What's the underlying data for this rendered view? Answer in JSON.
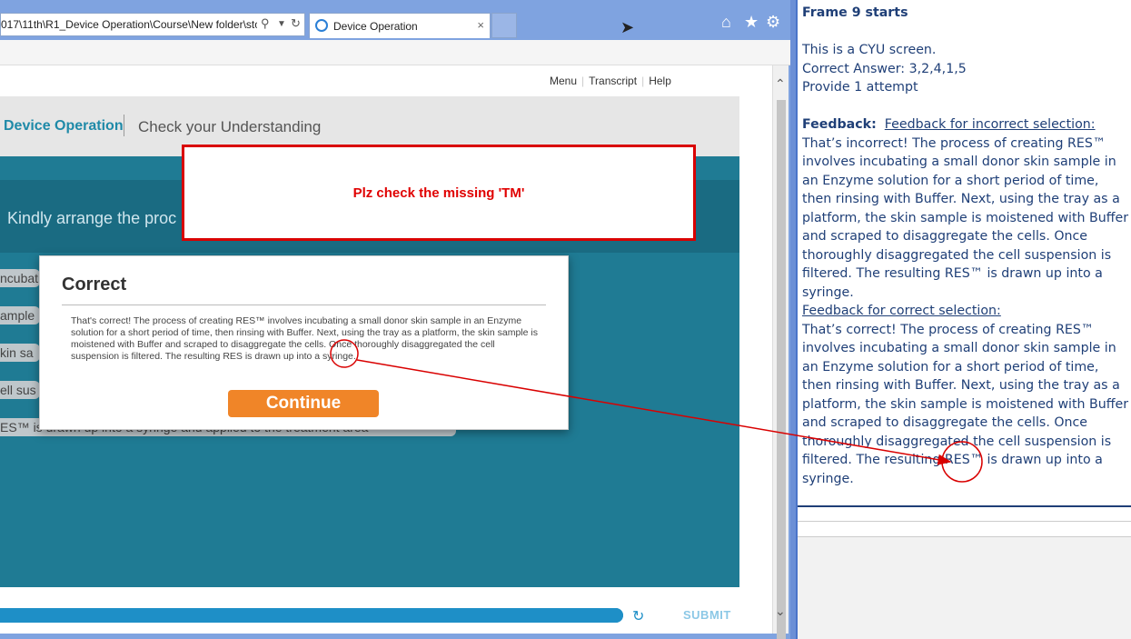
{
  "browser": {
    "address": "017\\11th\\R1_Device Operation\\Course\\New folder\\sto",
    "tab_title": "Device Operation",
    "tab_close": "×",
    "icons": [
      "search-icon",
      "dropdown-icon",
      "refresh-icon",
      "home-icon",
      "star-icon",
      "gear-icon"
    ]
  },
  "course": {
    "topnav": [
      "Menu",
      "Transcript",
      "Help"
    ],
    "title": "Device Operation",
    "section": "Check your Understanding",
    "question": "Kindly arrange the proc",
    "drag_items": [
      "ncubati",
      "ample",
      "kin sa",
      "ell sus",
      "ES™ is drawn up into a syringe and applied to the treatment area"
    ],
    "submit_label": "SUBMIT",
    "progress": 1.0
  },
  "modal": {
    "title": "Correct",
    "text": "That's correct! The process of creating RES™ involves incubating a small donor skin sample in an Enzyme solution for a short period of time, then rinsing with Buffer.  Next, using the tray as a platform, the skin sample is moistened with Buffer and scraped to disaggregate the cells.  Once thoroughly disaggregated the cell suspension is filtered. The resulting RES is drawn up into a syringe.",
    "button": "Continue"
  },
  "review_note": "Plz check the missing 'TM'",
  "script": {
    "frame": "Frame 9 starts",
    "line1": "This is a CYU screen.",
    "line2": "Correct Answer: 3,2,4,1,5",
    "line3": "Provide 1 attempt",
    "feedback_label": "Feedback:",
    "incorrect_heading": "Feedback for incorrect selection:",
    "incorrect_text": "That’s incorrect! The process of creating RES™ involves incubating a small donor skin sample in an Enzyme solution for a short period of time, then rinsing with Buffer. Next, using the tray as a platform, the skin sample is moistened with Buffer and scraped to disaggregate the cells. Once thoroughly disaggregated the cell suspension is filtered. The resulting RES™ is drawn up into a syringe.",
    "correct_heading": "Feedback for correct selection:",
    "correct_text": "That’s correct! The process of creating RES™ involves incubating a small donor skin sample in an Enzyme solution for a short period of time, then rinsing with Buffer. Next, using the tray as a platform, the skin sample is moistened with Buffer and scraped to disaggregate the cells. Once thoroughly disaggregated the cell suspension is filtered. The resulting RES™ is drawn up into a syringe."
  },
  "colors": {
    "annotation": "#d90000",
    "brand": "#1f8aa8",
    "continue": "#f08528"
  }
}
